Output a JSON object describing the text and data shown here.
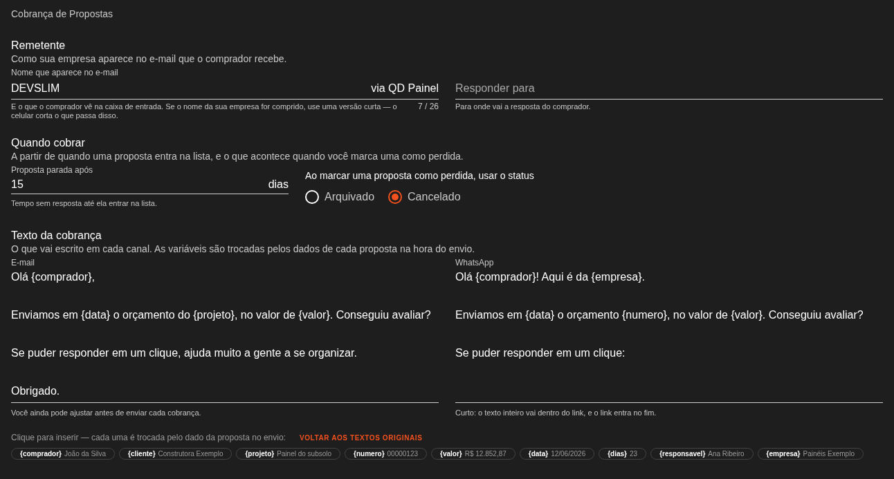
{
  "page_title": "Cobrança de Propostas",
  "sender": {
    "heading": "Remetente",
    "description": "Como sua empresa aparece no e-mail que o comprador recebe.",
    "name_field": {
      "label": "Nome que aparece no e-mail",
      "value": "DEVSLIM",
      "suffix": "via QD Painel",
      "hint": "E o que o comprador vê na caixa de entrada. Se o nome da sua empresa for comprido, use uma versão curta — o celular corta o que passa disso.",
      "counter": "7 / 26"
    },
    "reply_field": {
      "placeholder": "Responder para",
      "hint": "Para onde vai a resposta do comprador."
    }
  },
  "when": {
    "heading": "Quando cobrar",
    "description": "A partir de quando uma proposta entra na lista, e o que acontece quando você marca uma como perdida.",
    "days_field": {
      "label": "Proposta parada após",
      "value": "15",
      "suffix": "dias",
      "hint": "Tempo sem resposta até ela entrar na lista."
    },
    "status_group": {
      "label": "Ao marcar uma proposta como perdida, usar o status",
      "options": [
        {
          "label": "Arquivado",
          "selected": false
        },
        {
          "label": "Cancelado",
          "selected": true
        }
      ]
    }
  },
  "text": {
    "heading": "Texto da cobrança",
    "description": "O que vai escrito em cada canal. As variáveis são trocadas pelos dados de cada proposta na hora do envio.",
    "fields": [
      {
        "label": "E-mail",
        "paragraphs": [
          "Olá {comprador},",
          "Enviamos em {data} o orçamento do {projeto}, no valor de {valor}. Conseguiu avaliar?",
          "Se puder responder em um clique, ajuda muito a gente a se organizar.",
          "Obrigado."
        ],
        "hint": "Você ainda pode ajustar antes de enviar cada cobrança."
      },
      {
        "label": "WhatsApp",
        "paragraphs": [
          "Olá {comprador}! Aqui é da {empresa}.",
          "Enviamos em {data} o orçamento {numero}, no valor de {valor}. Conseguiu avaliar?",
          "Se puder responder em um clique:"
        ],
        "hint": "Curto: o texto inteiro vai dentro do link, e o link entra no fim."
      }
    ]
  },
  "variables": {
    "intro": "Clique para inserir — cada uma é trocada pelo dado da proposta no envio:",
    "reset_link": "VOLTAR AOS TEXTOS ORIGINAIS",
    "chips": [
      {
        "name": "{comprador}",
        "example": "João da Silva"
      },
      {
        "name": "{cliente}",
        "example": "Construtora Exemplo"
      },
      {
        "name": "{projeto}",
        "example": "Painel do subsolo"
      },
      {
        "name": "{numero}",
        "example": "00000123"
      },
      {
        "name": "{valor}",
        "example": "R$ 12.852,87"
      },
      {
        "name": "{data}",
        "example": "12/06/2026"
      },
      {
        "name": "{dias}",
        "example": "23"
      },
      {
        "name": "{responsavel}",
        "example": "Ana Ribeiro"
      },
      {
        "name": "{empresa}",
        "example": "Painéis Exemplo"
      }
    ]
  }
}
